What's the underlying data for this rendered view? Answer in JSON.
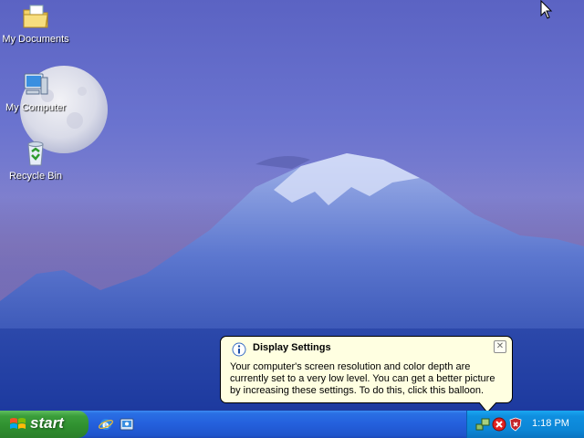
{
  "desktop": {
    "icons": [
      {
        "label": "My Documents",
        "icon": "folder-documents-icon"
      },
      {
        "label": "My Computer",
        "icon": "computer-icon"
      },
      {
        "label": "Recycle Bin",
        "icon": "recycle-bin-icon"
      }
    ]
  },
  "balloon": {
    "title": "Display Settings",
    "body": "Your computer's screen resolution and color depth are currently set to a very low level. You can get a better picture by increasing these settings. To do this, click this balloon.",
    "close_glyph": "✕",
    "icon": "info-icon"
  },
  "taskbar": {
    "start_label": "start",
    "quick_launch": [
      "internet-explorer-icon",
      "show-desktop-icon"
    ],
    "tray_icons": [
      "network-icon",
      "security-alert-icon",
      "security-center-icon"
    ],
    "clock": "1:18 PM"
  },
  "colors": {
    "taskbar": "#245fdc",
    "start": "#3b9e3b",
    "tray": "#0c86d6",
    "balloon": "#ffffe1"
  }
}
